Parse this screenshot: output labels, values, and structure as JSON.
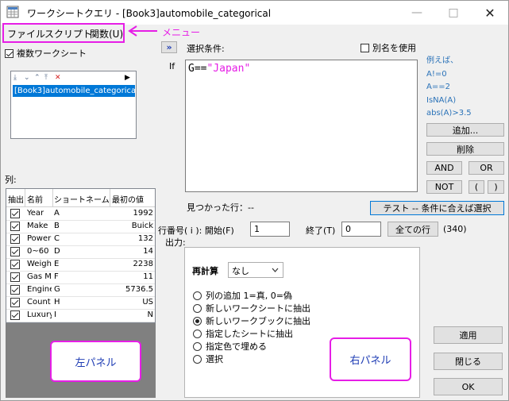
{
  "window": {
    "title": "ワークシートクエリ - [Book3]automobile_categorical",
    "controls": [
      "minimize-icon",
      "maximize-icon",
      "close-icon"
    ]
  },
  "menu": {
    "items": [
      "ファイル",
      "スクリプト",
      "関数(U)"
    ],
    "callout": "メニュー"
  },
  "left": {
    "multi_sheet_label": "複数ワークシート",
    "multi_sheet_checked": true,
    "sheet_list": {
      "toolbar_icons": [
        "arrow-down-bottom-icon",
        "arrow-down-icon",
        "arrow-up-icon",
        "arrow-up-top-icon",
        "delete-icon",
        "play-icon"
      ],
      "items": [
        "[Book3]automobile_categorica"
      ]
    },
    "columns_label": "列:",
    "grid": {
      "headers": [
        "抽出",
        "名前",
        "ショートネーム",
        "最初の値"
      ],
      "rows": [
        {
          "checked": true,
          "name": "Year",
          "short": "A",
          "first": "1992"
        },
        {
          "checked": true,
          "name": "Make",
          "short": "B",
          "first": "Buick"
        },
        {
          "checked": true,
          "name": "Power",
          "short": "C",
          "first": "132"
        },
        {
          "checked": true,
          "name": "0~60 r",
          "short": "D",
          "first": "14"
        },
        {
          "checked": true,
          "name": "Weigh",
          "short": "E",
          "first": "2238"
        },
        {
          "checked": true,
          "name": "Gas M",
          "short": "F",
          "first": "11"
        },
        {
          "checked": true,
          "name": "Engine",
          "short": "G",
          "first": "5736.5"
        },
        {
          "checked": true,
          "name": "Count",
          "short": "H",
          "first": "US"
        },
        {
          "checked": true,
          "name": "Luxury",
          "short": "I",
          "first": "N"
        }
      ]
    },
    "panel_label": "左パネル"
  },
  "right": {
    "expand_button": "»",
    "condition_label": "選択条件:",
    "alias_label": "別名を使用",
    "alias_checked": false,
    "if_label": "If",
    "condition": {
      "prefix": "G==",
      "value": "\"Japan\""
    },
    "hints": [
      "例えば、",
      "A!=0",
      "A==2",
      "IsNA(A)",
      "abs(A)>3.5"
    ],
    "buttons": {
      "add": "追加...",
      "delete": "削除",
      "and": "AND",
      "or": "OR",
      "not": "NOT",
      "lparen": "(",
      "rparen": ")"
    },
    "found_rows": "見つかった行：--",
    "test_button": "テスト -- 条件に合えば選択",
    "row_range": {
      "label": "行番号( i ): 開始(F)",
      "start": "1",
      "end_label": "終了(T)",
      "end": "0",
      "all_button": "全ての行",
      "count": "(340)"
    },
    "output_label": "出力:",
    "recalc_label": "再計算",
    "recalc_value": "なし",
    "options": [
      {
        "label": "列の追加 1=真, 0=偽",
        "selected": false
      },
      {
        "label": "新しいワークシートに抽出",
        "selected": false
      },
      {
        "label": "新しいワークブックに抽出",
        "selected": true
      },
      {
        "label": "指定したシートに抽出",
        "selected": false
      },
      {
        "label": "指定色で埋める",
        "selected": false
      },
      {
        "label": "選択",
        "selected": false
      }
    ],
    "panel_label": "右パネル",
    "apply": "適用",
    "close": "閉じる",
    "ok": "OK"
  },
  "colors": {
    "accent": "#e61ee6",
    "selection": "#0078d7",
    "string": "#e61ee6",
    "hint": "#2a72b8"
  }
}
